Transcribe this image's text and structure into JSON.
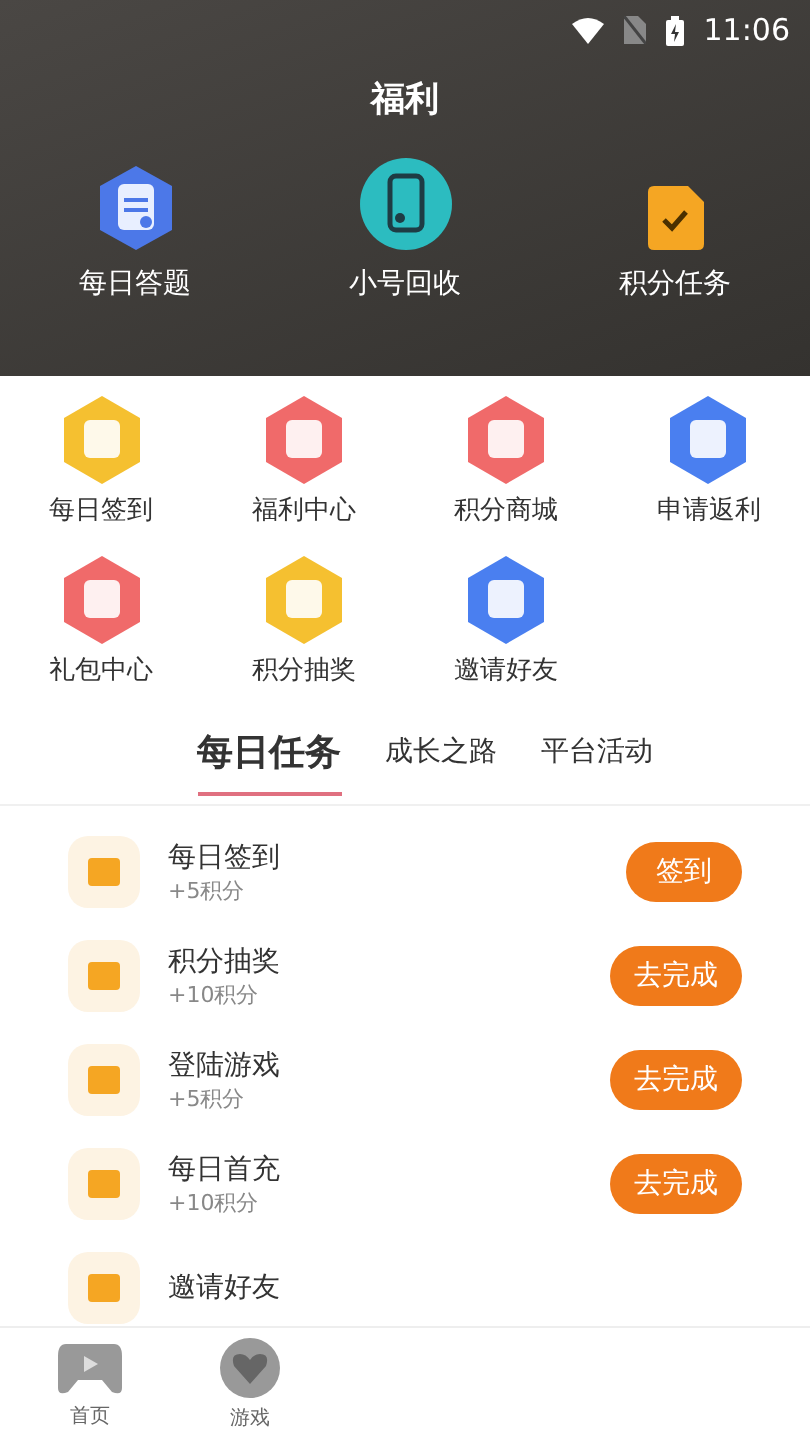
{
  "status_bar": {
    "time": "11:06"
  },
  "header": {
    "title": "福利",
    "shortcuts": [
      {
        "label": "每日答题"
      },
      {
        "label": "小号回收"
      },
      {
        "label": "积分任务"
      }
    ]
  },
  "grid": [
    {
      "label": "每日签到",
      "color": "#f5c030"
    },
    {
      "label": "福利中心",
      "color": "#f06a6a"
    },
    {
      "label": "积分商城",
      "color": "#f06a6a"
    },
    {
      "label": "申请返利",
      "color": "#4a7ff0"
    },
    {
      "label": "礼包中心",
      "color": "#f06a6a"
    },
    {
      "label": "积分抽奖",
      "color": "#f5c030"
    },
    {
      "label": "邀请好友",
      "color": "#4a7ff0"
    }
  ],
  "tabs": [
    {
      "label": "每日任务",
      "selected": true
    },
    {
      "label": "成长之路",
      "selected": false
    },
    {
      "label": "平台活动",
      "selected": false
    }
  ],
  "tasks": [
    {
      "title": "每日签到",
      "reward": "+5积分",
      "action": "签到"
    },
    {
      "title": "积分抽奖",
      "reward": "+10积分",
      "action": "去完成"
    },
    {
      "title": "登陆游戏",
      "reward": "+5积分",
      "action": "去完成"
    },
    {
      "title": "每日首充",
      "reward": "+10积分",
      "action": "去完成"
    },
    {
      "title": "邀请好友"
    }
  ],
  "bottom_nav": [
    {
      "label": "首页"
    },
    {
      "label": "游戏"
    }
  ]
}
